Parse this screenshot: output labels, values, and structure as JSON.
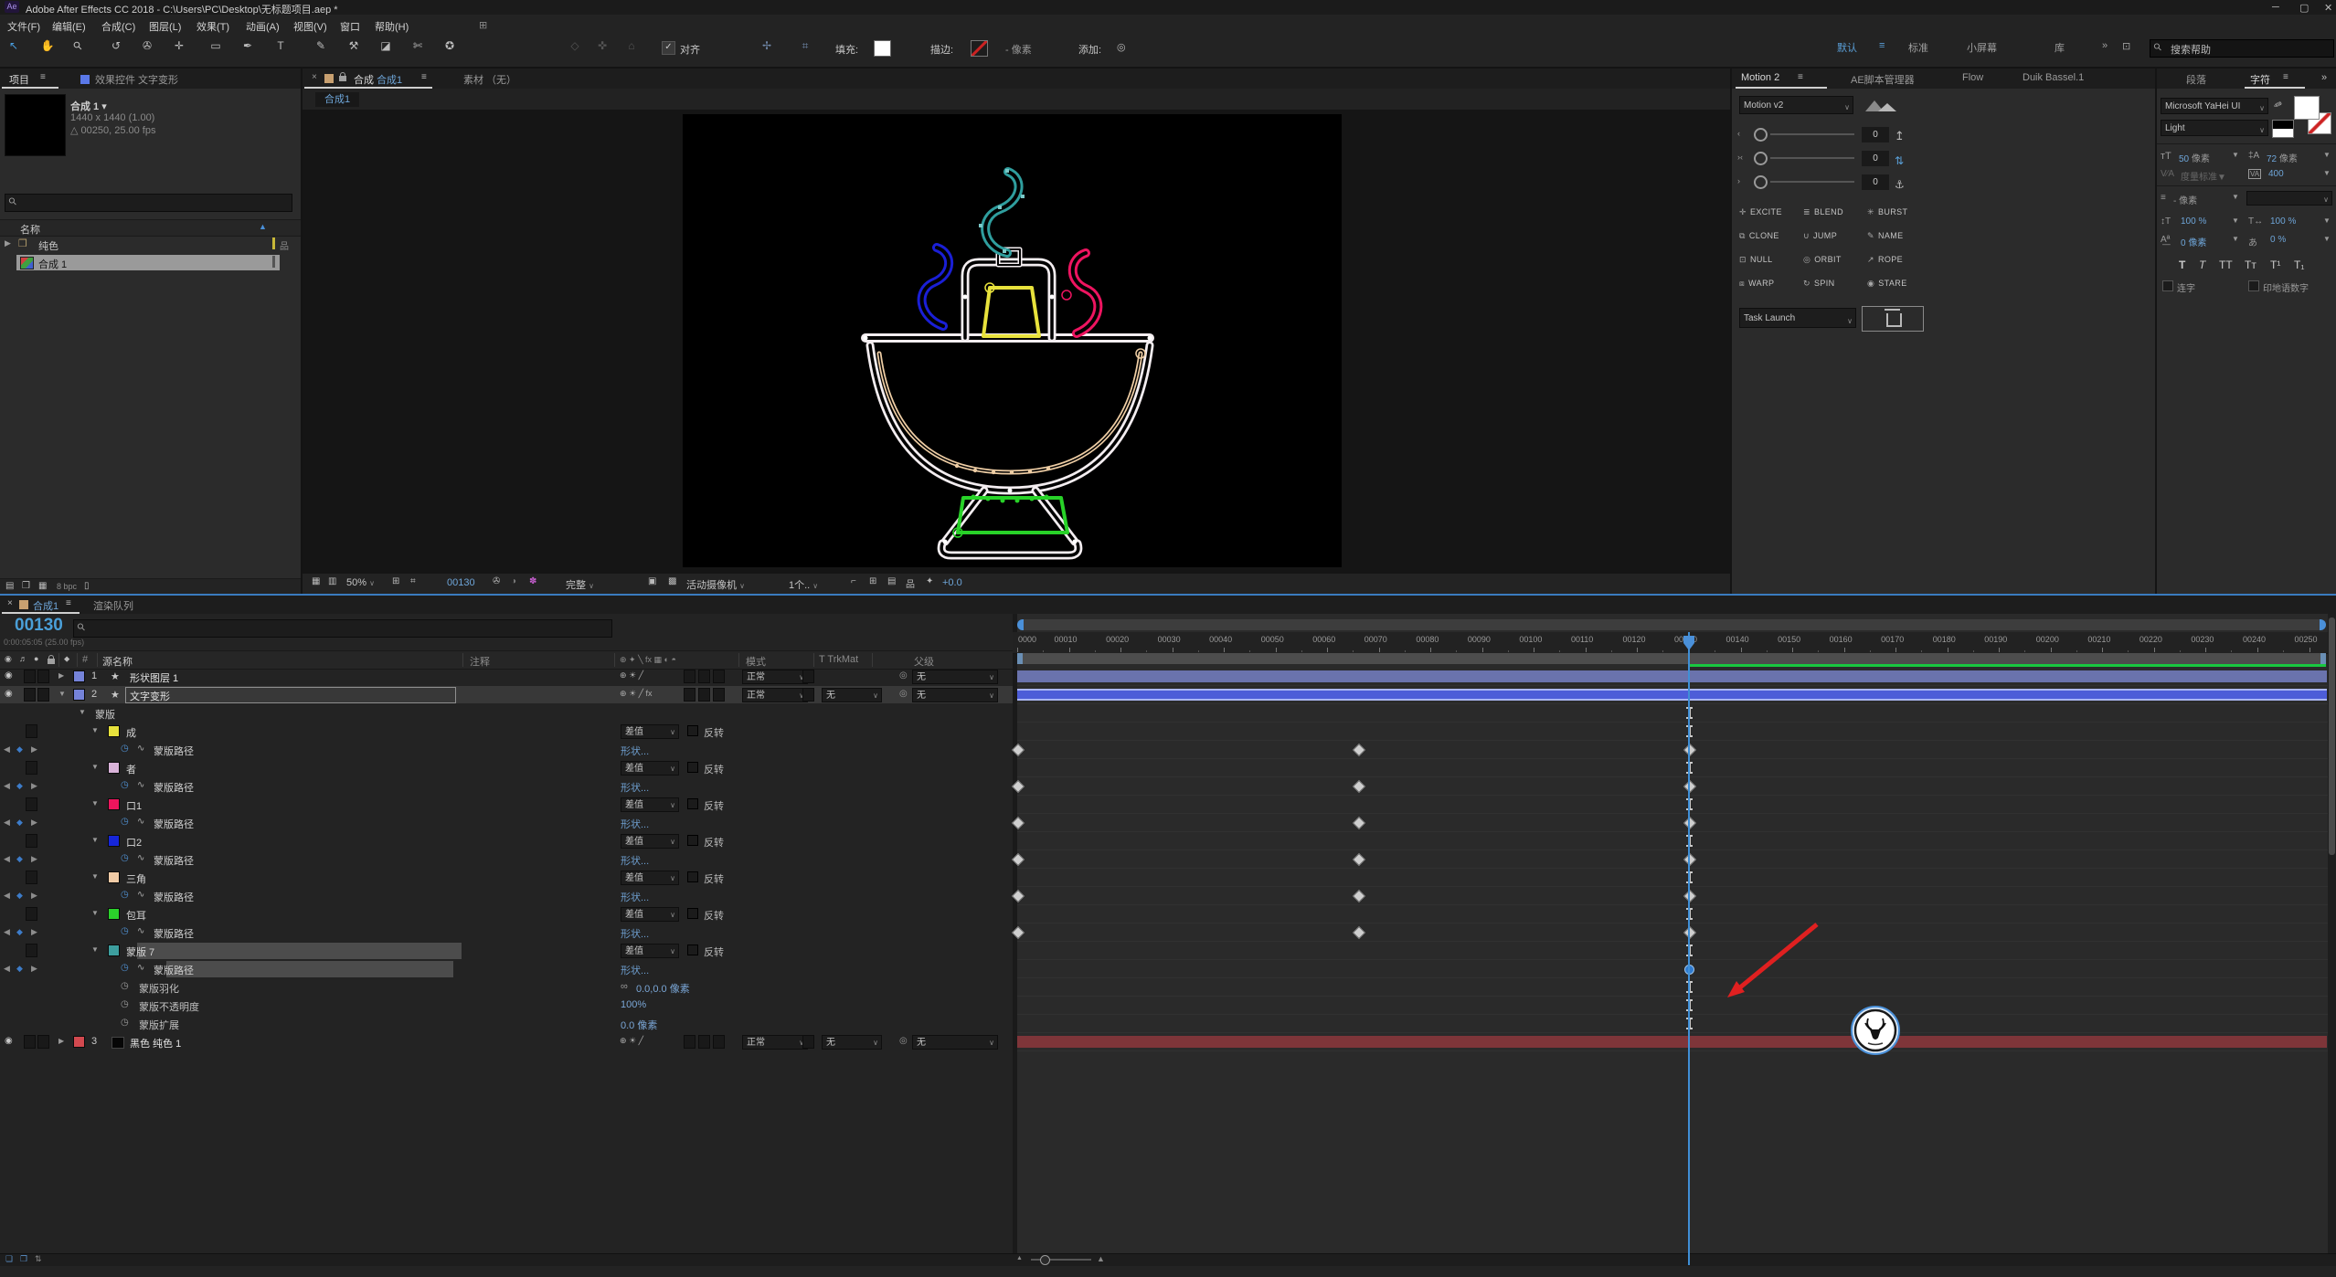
{
  "window": {
    "logo": "Ae",
    "title": "Adobe After Effects CC 2018 - C:\\Users\\PC\\Desktop\\无标题项目.aep *"
  },
  "menu": {
    "items": [
      "文件(F)",
      "编辑(E)",
      "合成(C)",
      "图层(L)",
      "效果(T)",
      "动画(A)",
      "视图(V)",
      "窗口",
      "帮助(H)"
    ]
  },
  "toolbar": {
    "tools": [
      {
        "name": "selection-tool",
        "glyph": "↖"
      },
      {
        "name": "hand-tool",
        "glyph": "✋"
      },
      {
        "name": "zoom-tool",
        "glyph": "⚲"
      },
      {
        "name": "rotation-tool",
        "glyph": "↺"
      },
      {
        "name": "camera-tool",
        "glyph": "✇"
      },
      {
        "name": "pan-behind-tool",
        "glyph": "✛"
      },
      {
        "name": "rectangle-tool",
        "glyph": "▭"
      },
      {
        "name": "pen-tool",
        "glyph": "✒"
      },
      {
        "name": "type-tool",
        "glyph": "T"
      },
      {
        "name": "brush-tool",
        "glyph": "✎"
      },
      {
        "name": "clone-stamp-tool",
        "glyph": "⚒"
      },
      {
        "name": "eraser-tool",
        "glyph": "◪"
      },
      {
        "name": "roto-brush-tool",
        "glyph": "✄"
      },
      {
        "name": "puppet-pin-tool",
        "glyph": "✪"
      }
    ],
    "align_label": "对齐",
    "fill_label": "填充:",
    "stroke_label": "描边:",
    "pixel_label": "- 像素",
    "add_label": "添加:",
    "workspaces": [
      "默认",
      "标准",
      "小屏幕",
      "库"
    ],
    "more_glyph": "»",
    "search_placeholder": "搜索帮助"
  },
  "project": {
    "tab_project": "项目",
    "tab_effects": "效果控件 文字变形",
    "comp_name": "合成 1",
    "comp_size": "1440 x 1440 (1.00)",
    "comp_duration": "△ 00250, 25.00 fps",
    "name_header": "名称",
    "rows": [
      {
        "label": "纯色",
        "type": "folder"
      },
      {
        "label": "合成 1",
        "type": "comp",
        "selected": true
      }
    ],
    "footer_bpc": "8 bpc"
  },
  "viewer": {
    "tab_label": "合成",
    "tab_comp": "合成1",
    "tab_footage": "素材 （无）",
    "subtab": "合成1",
    "zoom": "50%",
    "timecode": "00130",
    "resolution": "完整",
    "camera": "活动摄像机",
    "view_count": "1个..",
    "exposure": "+0.0"
  },
  "motion": {
    "tabs": [
      "Motion 2",
      "AE脚本管理器",
      "Flow",
      "Duik Bassel.1"
    ],
    "preset": "Motion v2",
    "slider_values": [
      "0",
      "0",
      "0"
    ],
    "buttons": [
      {
        "name": "excite",
        "glyph": "✛",
        "label": "EXCITE"
      },
      {
        "name": "blend",
        "glyph": "≣",
        "label": "BLEND"
      },
      {
        "name": "burst",
        "glyph": "✳",
        "label": "BURST"
      },
      {
        "name": "clone",
        "glyph": "⧉",
        "label": "CLONE"
      },
      {
        "name": "jump",
        "glyph": "∪",
        "label": "JUMP"
      },
      {
        "name": "name",
        "glyph": "✎",
        "label": "NAME"
      },
      {
        "name": "null",
        "glyph": "⊡",
        "label": "NULL"
      },
      {
        "name": "orbit",
        "glyph": "◎",
        "label": "ORBIT"
      },
      {
        "name": "rope",
        "glyph": "↗",
        "label": "ROPE"
      },
      {
        "name": "warp",
        "glyph": "⧈",
        "label": "WARP"
      },
      {
        "name": "spin",
        "glyph": "↻",
        "label": "SPIN"
      },
      {
        "name": "stare",
        "glyph": "◉",
        "label": "STARE"
      }
    ],
    "task": "Task Launch"
  },
  "character": {
    "tab_paragraph": "段落",
    "tab_character": "字符",
    "font_family": "Microsoft YaHei UI",
    "font_style": "Light",
    "font_size": "50",
    "leading": "72",
    "px": "像素",
    "kerning": "度量标准",
    "tracking": "400",
    "stroke_px": "- 像素",
    "vscale": "100 %",
    "hscale": "100 %",
    "baseline": "0 像素",
    "tsume": "0 %",
    "ligatures": "连字",
    "hindi": "印地语数字"
  },
  "timeline": {
    "tab_comp": "合成1",
    "tab_render": "渲染队列",
    "timecode": "00130",
    "timecode_detail": "0:00:05:05 (25.00 fps)",
    "col_source": "源名称",
    "col_comment": "注释",
    "col_mode": "模式",
    "col_trkmat": "T TrkMat",
    "col_parent": "父级",
    "switch_header": "⊕ ✦ ╲ fx ▦ ◐ ◓",
    "mode_normal": "正常",
    "mode_difference": "差值",
    "invert_label": "反转",
    "none_label": "无",
    "shape_label": "形状...",
    "rows": [
      {
        "type": "layer",
        "num": "1",
        "name": "形状图层 1",
        "swatch": "#7583d9",
        "bar": "#6a73ad",
        "fx": false,
        "trkmat": false
      },
      {
        "type": "layer",
        "num": "2",
        "name": "文字变形",
        "swatch": "#7583d9",
        "bar": "#4d5dd8",
        "fx": true,
        "trkmat": true,
        "selected": true,
        "expanded": true
      },
      {
        "type": "group",
        "name": "蒙版"
      },
      {
        "type": "mask",
        "name": "成",
        "swatch": "#e6e13c"
      },
      {
        "type": "path",
        "name": "蒙版路径",
        "kf": [
          0,
          66,
          130
        ]
      },
      {
        "type": "mask",
        "name": "者",
        "swatch": "#d9b3d9"
      },
      {
        "type": "path",
        "name": "蒙版路径",
        "kf": [
          0,
          66,
          130
        ]
      },
      {
        "type": "mask",
        "name": "口1",
        "swatch": "#ed155d"
      },
      {
        "type": "path",
        "name": "蒙版路径",
        "kf": [
          0,
          66,
          130
        ]
      },
      {
        "type": "mask",
        "name": "口2",
        "swatch": "#1626d9"
      },
      {
        "type": "path",
        "name": "蒙版路径",
        "kf": [
          0,
          66,
          130
        ]
      },
      {
        "type": "mask",
        "name": "三角",
        "swatch": "#f0cba6"
      },
      {
        "type": "path",
        "name": "蒙版路径",
        "kf": [
          0,
          66,
          130
        ]
      },
      {
        "type": "mask",
        "name": "包耳",
        "swatch": "#2bd12b"
      },
      {
        "type": "path",
        "name": "蒙版路径",
        "kf": [
          0,
          66,
          130
        ]
      },
      {
        "type": "mask",
        "name": "蒙版 7",
        "swatch": "#3d9e9e",
        "selected": true
      },
      {
        "type": "path",
        "name": "蒙版路径",
        "kf": [
          130
        ],
        "kf_style": "circle",
        "selected": true
      },
      {
        "type": "prop",
        "name": "蒙版羽化",
        "value": "0.0,0.0 像素",
        "link": true
      },
      {
        "type": "prop",
        "name": "蒙版不透明度",
        "value": "100%"
      },
      {
        "type": "prop",
        "name": "蒙版扩展",
        "value": "0.0 像素"
      },
      {
        "type": "layer",
        "num": "3",
        "name": "黑色 纯色 1",
        "swatch": "#d2494f",
        "bar": "#7e3539",
        "fx": false,
        "trkmat": true,
        "solid": true
      }
    ],
    "ruler": {
      "frame_labels": [
        "0000",
        "00010",
        "00020",
        "00030",
        "00040",
        "00050",
        "00060",
        "00070",
        "00080",
        "00090",
        "00100",
        "00110",
        "00120",
        "00130",
        "00140",
        "00150",
        "00160",
        "00170",
        "00180",
        "00190",
        "00200",
        "00210",
        "00220",
        "00230",
        "00240",
        "00250"
      ],
      "playhead_frame": 130
    }
  },
  "colors": {
    "accent_blue": "#4a90d9",
    "cache_green": "#19c840",
    "annotation_red": "#e02020",
    "selected_bar": "#4d5dd8",
    "solid_bar": "#7e3539"
  }
}
